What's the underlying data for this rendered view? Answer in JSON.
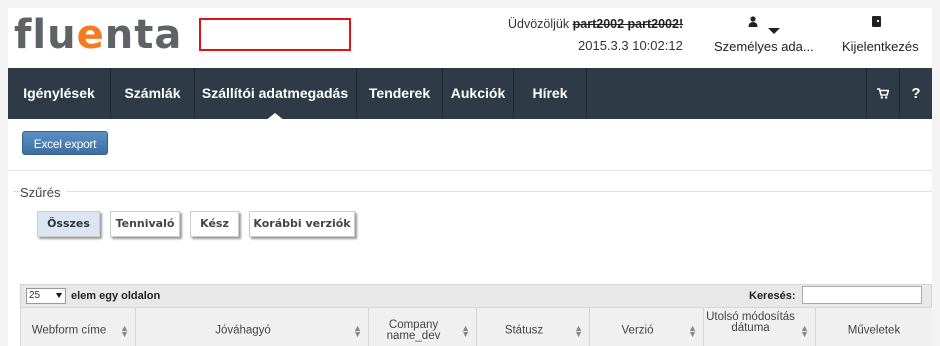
{
  "header": {
    "logo_left": "flu",
    "logo_accent": "e",
    "logo_right": "nta",
    "welcome_prefix": "Üdvözöljük",
    "welcome_user": "part2002 part2002!",
    "datetime": "2015.3.3 10:02:12",
    "user_menu_label": "Személyes ada...",
    "logout_label": "Kijelentkezés",
    "user_icon": "user-icon",
    "logout_icon": "door-icon"
  },
  "nav": {
    "items": [
      {
        "label": "Igénylések"
      },
      {
        "label": "Számlák"
      },
      {
        "label": "Szállítói adatmegadás"
      },
      {
        "label": "Tenderek"
      },
      {
        "label": "Aukciók"
      },
      {
        "label": "Hírek"
      }
    ],
    "active_index": 2,
    "cart_icon": "cart-icon",
    "help_label": "?"
  },
  "toolbar": {
    "excel_label": "Excel export"
  },
  "filter": {
    "legend": "Szűrés",
    "buttons": [
      {
        "label": "Összes",
        "selected": true
      },
      {
        "label": "Tennivaló",
        "selected": false
      },
      {
        "label": "Kész",
        "selected": false
      },
      {
        "label": "Korábbi verziók",
        "selected": false
      }
    ]
  },
  "table": {
    "page_size": "25",
    "page_size_label": "elem egy oldalon",
    "search_label": "Keresés:",
    "search_value": "",
    "columns": [
      {
        "label": "Webform címe"
      },
      {
        "label": "Jóváhagyó"
      },
      {
        "label": "Company name_dev"
      },
      {
        "label": "Státusz"
      },
      {
        "label": "Verzió"
      },
      {
        "label": "Utolsó módosítás dátuma"
      },
      {
        "label": "Műveletek"
      }
    ]
  },
  "colors": {
    "nav_bg": "#2e3b47",
    "accent": "#f47b20",
    "active_outline": "#e0131b",
    "button_blue": "#3d6fa3"
  }
}
